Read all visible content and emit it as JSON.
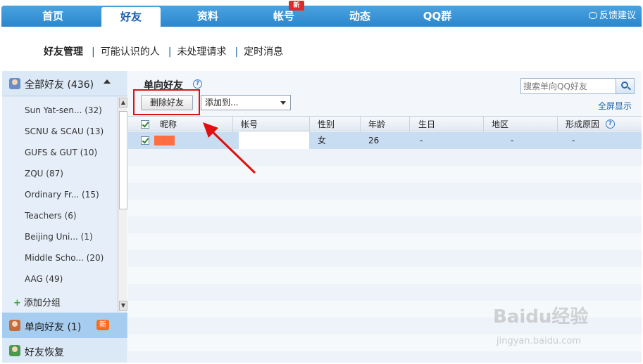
{
  "nav": {
    "items": [
      "首页",
      "好友",
      "资料",
      "帐号",
      "动态",
      "QQ群"
    ],
    "new_badge": "新",
    "feedback": "反馈建议"
  },
  "subnav": {
    "items": [
      "好友管理",
      "可能认识的人",
      "未处理请求",
      "定时消息"
    ]
  },
  "sidebar": {
    "all_friends": "全部好友 (436)",
    "groups": [
      "Sun Yat-sen... (32)",
      "SCNU & SCAU (13)",
      "GUFS & GUT (10)",
      "ZQU (87)",
      "Ordinary Fr... (15)",
      "Teachers (6)",
      "Beijing Uni... (1)",
      "Middle Scho... (20)",
      "AAG (49)"
    ],
    "add_group": "添加分组",
    "one_way": "单向好友 (1)",
    "one_way_badge": "新",
    "recover": "好友恢复"
  },
  "main": {
    "title": "单向好友",
    "delete_button": "删除好友",
    "add_to": "添加到...",
    "search_placeholder": "搜索单向QQ好友",
    "fullscreen": "全屏显示",
    "columns": [
      "昵称",
      "帐号",
      "性别",
      "年龄",
      "生日",
      "地区",
      "形成原因"
    ],
    "row": {
      "gender": "女",
      "age": "26",
      "birthday": "-",
      "region": "-",
      "reason": "-"
    }
  },
  "watermark": {
    "brand": "Baidu经验",
    "url": "jingyan.baidu.com"
  },
  "colors": {
    "nav_blue": "#2b86cc",
    "highlight_red": "#e01010",
    "selected_row": "#c8dcf2"
  }
}
